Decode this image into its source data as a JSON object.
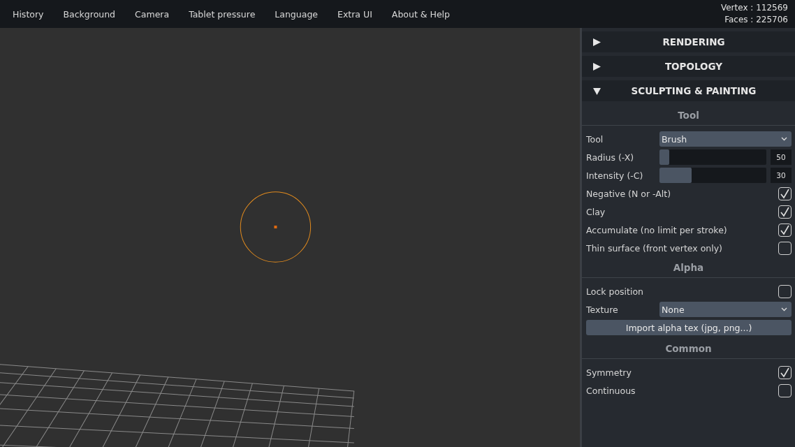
{
  "menu": [
    "History",
    "Background",
    "Camera",
    "Tablet pressure",
    "Language",
    "Extra UI",
    "About & Help"
  ],
  "stats": [
    "Vertex : 112569",
    "Faces : 225706"
  ],
  "folders": [
    {
      "title": "RENDERING",
      "expanded": false
    },
    {
      "title": "TOPOLOGY",
      "expanded": false
    },
    {
      "title": "SCULPTING & PAINTING",
      "expanded": true
    }
  ],
  "sections": [
    {
      "title": "Tool",
      "controls": [
        {
          "kind": "select",
          "label": "Tool",
          "value": "Brush"
        },
        {
          "kind": "slider",
          "label": "Radius (-X)",
          "level": 0.09,
          "reading": "50"
        },
        {
          "kind": "slider",
          "label": "Intensity (-C)",
          "level": 0.3,
          "reading": "30"
        },
        {
          "kind": "checkbox",
          "label": "Negative (N or -Alt)",
          "checked": true
        },
        {
          "kind": "checkbox",
          "label": "Clay",
          "checked": true
        },
        {
          "kind": "checkbox",
          "label": "Accumulate (no limit per stroke)",
          "checked": true
        },
        {
          "kind": "checkbox",
          "label": "Thin surface (front vertex only)",
          "checked": false
        }
      ]
    },
    {
      "title": "Alpha",
      "controls": [
        {
          "kind": "checkbox",
          "label": "Lock position",
          "checked": false
        },
        {
          "kind": "select",
          "label": "Texture",
          "value": "None"
        },
        {
          "kind": "button",
          "label": "Import alpha tex (jpg, png...)"
        }
      ]
    },
    {
      "title": "Common",
      "controls": [
        {
          "kind": "checkbox",
          "label": "Symmetry",
          "checked": true
        },
        {
          "kind": "checkbox",
          "label": "Continuous",
          "checked": false
        }
      ]
    }
  ]
}
